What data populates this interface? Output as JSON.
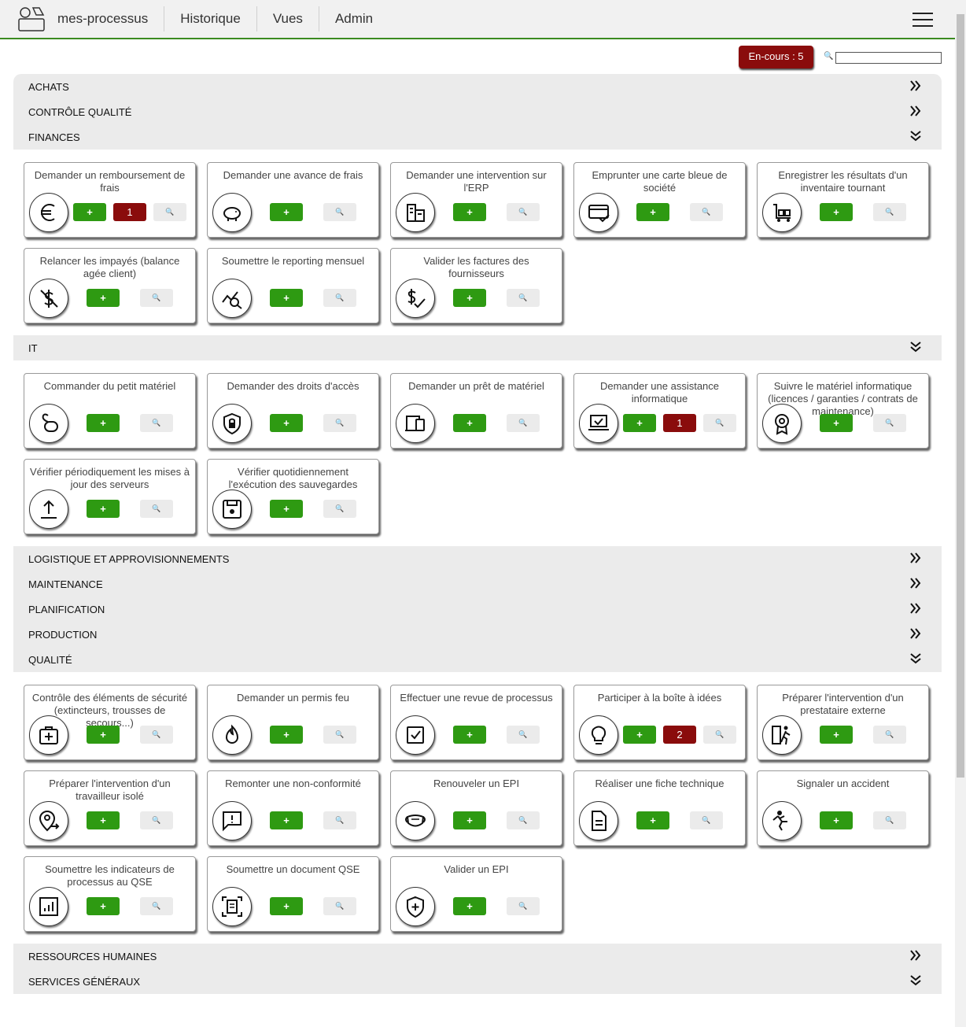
{
  "navbar": {
    "brand": "mes-processus",
    "links": [
      "Historique",
      "Vues",
      "Admin"
    ]
  },
  "toolbar": {
    "encours_label": "En-cours : 5",
    "search_icon": "magnifier-icon"
  },
  "buttons": {
    "add": "+",
    "view": "🔍"
  },
  "categories": [
    {
      "name": "ACHATS",
      "expanded": false
    },
    {
      "name": "CONTRÔLE QUALITÉ",
      "expanded": false
    },
    {
      "name": "FINANCES",
      "expanded": true,
      "cards": [
        {
          "title": "Demander un remboursement de frais",
          "icon": "euro-icon",
          "count": "1"
        },
        {
          "title": "Demander une avance de frais",
          "icon": "piggy-bank-icon"
        },
        {
          "title": "Demander une intervention sur l'ERP",
          "icon": "building-icon"
        },
        {
          "title": "Emprunter une carte bleue de société",
          "icon": "credit-card-check-icon"
        },
        {
          "title": "Enregistrer les résultats d'un inventaire tournant",
          "icon": "trolley-icon"
        },
        {
          "title": "Relancer les impayés (balance agée client)",
          "icon": "no-money-icon"
        },
        {
          "title": "Soumettre le reporting mensuel",
          "icon": "chart-search-icon"
        },
        {
          "title": "Valider les factures des fournisseurs",
          "icon": "dollar-check-icon"
        }
      ]
    },
    {
      "name": "IT",
      "expanded": true,
      "cards": [
        {
          "title": "Commander du petit matériel",
          "icon": "mouse-cable-icon"
        },
        {
          "title": "Demander des droits d'accès",
          "icon": "shield-lock-icon"
        },
        {
          "title": "Demander un prêt de matériel",
          "icon": "devices-icon"
        },
        {
          "title": "Demander une assistance informatique",
          "icon": "laptop-check-icon",
          "count": "1"
        },
        {
          "title": "Suivre le matériel informatique (licences / garanties / contrats de maintenance)",
          "icon": "award-icon"
        },
        {
          "title": "Vérifier périodiquement les mises à jour des serveurs",
          "icon": "upload-icon"
        },
        {
          "title": "Vérifier quotidiennement l'exécution des sauvegardes",
          "icon": "floppy-icon"
        }
      ]
    },
    {
      "name": "LOGISTIQUE ET APPROVISIONNEMENTS",
      "expanded": false
    },
    {
      "name": "MAINTENANCE",
      "expanded": false
    },
    {
      "name": "PLANIFICATION",
      "expanded": false
    },
    {
      "name": "PRODUCTION",
      "expanded": false
    },
    {
      "name": "QUALITÉ",
      "expanded": true,
      "cards": [
        {
          "title": "Contrôle des éléments de sécurité (extincteurs, trousses de secours...)",
          "icon": "first-aid-icon"
        },
        {
          "title": "Demander un permis feu",
          "icon": "fire-icon"
        },
        {
          "title": "Effectuer une revue de processus",
          "icon": "checkbox-icon"
        },
        {
          "title": "Participer à la boîte à idées",
          "icon": "lightbulb-icon",
          "count": "2"
        },
        {
          "title": "Préparer l'intervention d'un prestataire externe",
          "icon": "person-exit-icon"
        },
        {
          "title": "Préparer l'intervention d'un travailleur isolé",
          "icon": "person-location-icon"
        },
        {
          "title": "Remonter une non-conformité",
          "icon": "message-alert-icon"
        },
        {
          "title": "Renouveler un EPI",
          "icon": "mask-icon"
        },
        {
          "title": "Réaliser une fiche technique",
          "icon": "document-icon"
        },
        {
          "title": "Signaler un accident",
          "icon": "person-falling-icon"
        },
        {
          "title": "Soumettre les indicateurs de processus au QSE",
          "icon": "bar-chart-icon"
        },
        {
          "title": "Soumettre un document QSE",
          "icon": "document-scan-icon"
        },
        {
          "title": "Valider un EPI",
          "icon": "shield-plus-icon"
        }
      ]
    },
    {
      "name": "RESSOURCES HUMAINES",
      "expanded": false
    },
    {
      "name": "SERVICES GÉNÉRAUX",
      "expanded": true
    }
  ]
}
